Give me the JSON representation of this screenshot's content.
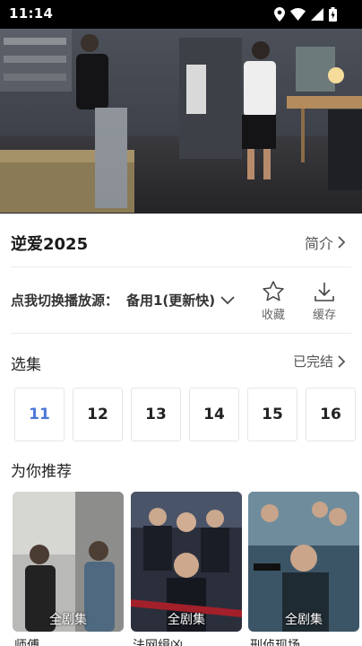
{
  "status_bar": {
    "time": "11:14"
  },
  "video": {
    "icons": [
      "video-frame"
    ]
  },
  "header": {
    "title": "逆爱2025",
    "intro_label": "简介"
  },
  "source": {
    "label": "点我切换播放源：",
    "value": "备用1(更新快)"
  },
  "actions": {
    "favorite_label": "收藏",
    "download_label": "缓存"
  },
  "episodes": {
    "title": "选集",
    "status": "已完结",
    "items": [
      "11",
      "12",
      "13",
      "14",
      "15",
      "16"
    ],
    "selected": "11"
  },
  "recommend": {
    "title": "为你推荐",
    "items": [
      {
        "name": "师傅",
        "badge": "全剧集"
      },
      {
        "name": "法网缉凶",
        "badge": "全剧集"
      },
      {
        "name": "刑侦现场",
        "badge": "全剧集"
      }
    ]
  },
  "colors": {
    "accent": "#4b78d8",
    "status_bar": "#000000"
  }
}
